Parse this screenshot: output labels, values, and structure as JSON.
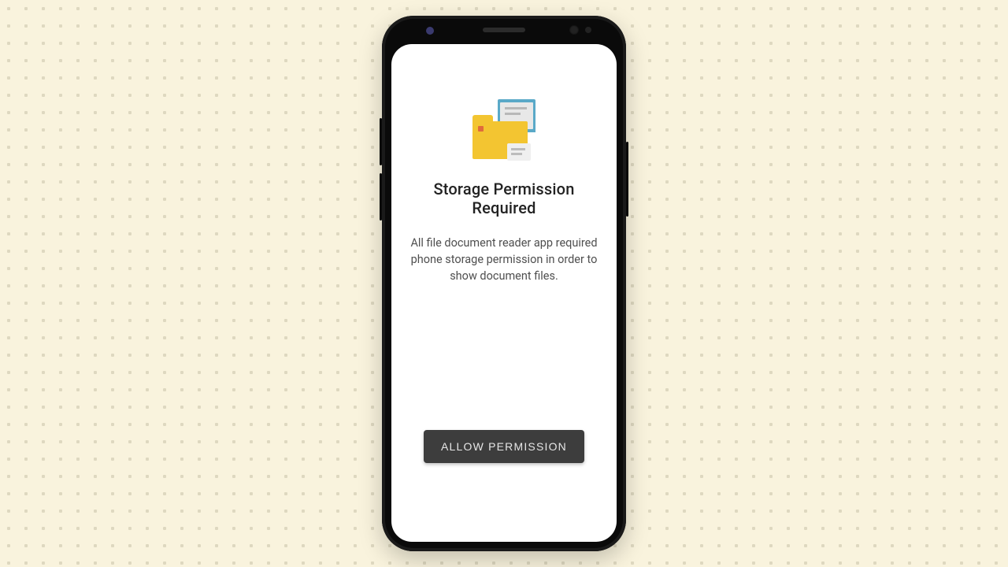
{
  "screen": {
    "heading": "Storage Permission Required",
    "body": "All file document reader app required phone storage permission in order to show  document files.",
    "button_label": "ALLOW PERMISSION"
  },
  "icons": {
    "folder": "folder-documents-icon"
  },
  "colors": {
    "background": "#f9f3dd",
    "button_bg": "#3d3d3d",
    "folder": "#f3c531",
    "doc_accent": "#5aa9c8"
  }
}
